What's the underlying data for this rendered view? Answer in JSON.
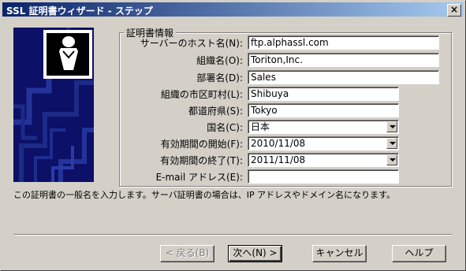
{
  "window": {
    "title": "SSL 証明書ウィザード - ステップ",
    "close_label": "×"
  },
  "group": {
    "legend": "証明書情報"
  },
  "fields": {
    "common_name": {
      "label": "サーバーのホスト名(N):",
      "value": "ftp.alphassl.com"
    },
    "organization": {
      "label": "組織名(O):",
      "value": "Toriton,Inc."
    },
    "department": {
      "label": "部署名(D):",
      "value": "Sales"
    },
    "city": {
      "label": "組織の市区町村(L):",
      "value": "Shibuya"
    },
    "state": {
      "label": "都道府県(S):",
      "value": "Tokyo"
    },
    "country": {
      "label": "国名(C):",
      "value": "日本"
    },
    "valid_from": {
      "label": "有効期間の開始(F):",
      "value": "2010/11/08"
    },
    "valid_to": {
      "label": "有効期間の終了(T):",
      "value": "2011/11/08"
    },
    "email": {
      "label": "E-mail アドレス(E):",
      "value": ""
    }
  },
  "hint": "この証明書の一般名を入力します。サーバ証明書の場合は、IP アドレスやドメイン名になります。",
  "buttons": {
    "back": "< 戻る(B)",
    "next": "次へ(N) >",
    "cancel": "キャンセル",
    "help": "ヘルプ"
  },
  "icons": {
    "banner": "certificate-person-icon",
    "combo_arrow": "chevron-down-icon"
  },
  "colors": {
    "titlebar_start": "#0a246a",
    "titlebar_end": "#a6caf0",
    "banner_bg": "#0c1066",
    "face": "#d4d0c8"
  }
}
